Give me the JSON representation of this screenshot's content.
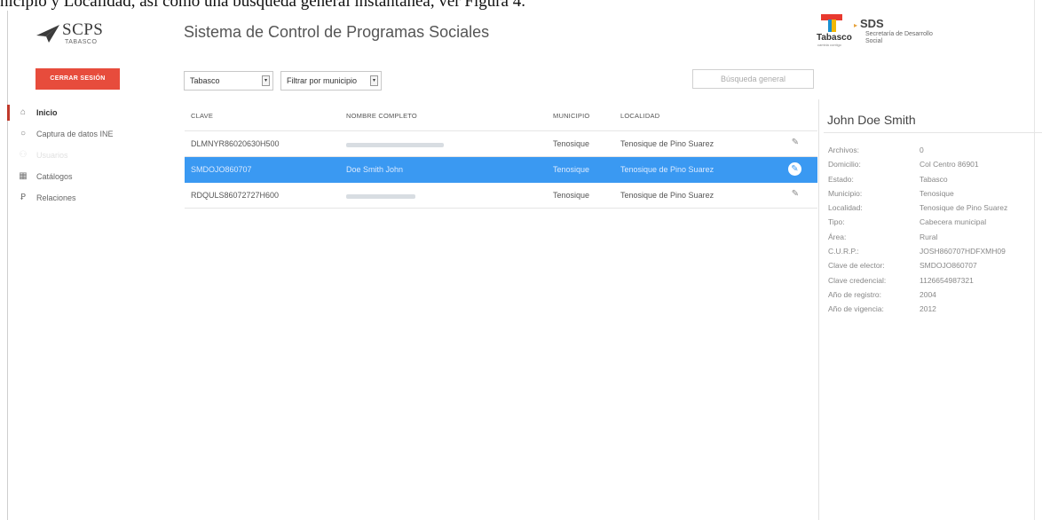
{
  "caption": "nicipio y Localidad, así como una búsqueda general instantánea, ver Figura 4.",
  "header": {
    "logo_title": "SCPS",
    "logo_subtitle": "TABASCO",
    "app_title": "Sistema de Control de Programas Sociales",
    "brand_state": "Tabasco",
    "brand_tagline": "cambia contigo",
    "brand_sds": "SDS",
    "brand_sds_sub": "Secretaría de Desarrollo Social",
    "logout_label": "CERRAR SESIÓN"
  },
  "filters": {
    "state_select": "Tabasco",
    "municipio_select": "Filtrar por municipio",
    "search_placeholder": "Búsqueda general"
  },
  "sidebar": {
    "items": [
      {
        "label": "Inicio",
        "icon": "home-icon",
        "state": "active"
      },
      {
        "label": "Captura de datos INE",
        "icon": "circle-icon",
        "state": "normal"
      },
      {
        "label": "Usuarios",
        "icon": "users-icon",
        "state": "disabled"
      },
      {
        "label": "Catálogos",
        "icon": "table-icon",
        "state": "normal"
      },
      {
        "label": "Relaciones",
        "icon": "relations-icon",
        "state": "normal"
      }
    ]
  },
  "table": {
    "columns": [
      "CLAVE",
      "NOMBRE COMPLETO",
      "MUNICIPIO",
      "LOCALIDAD"
    ],
    "rows": [
      {
        "clave": "DLMNYR86020630H500",
        "nombre": "",
        "municipio": "Tenosique",
        "localidad": "Tenosique de Pino Suarez",
        "selected": false
      },
      {
        "clave": "SMDOJO860707",
        "nombre": "Doe Smith John",
        "municipio": "Tenosique",
        "localidad": "Tenosique de Pino Suarez",
        "selected": true
      },
      {
        "clave": "RDQULS86072727H600",
        "nombre": "",
        "municipio": "Tenosique",
        "localidad": "Tenosique de Pino Suarez",
        "selected": false
      }
    ]
  },
  "detail": {
    "name": "John Doe Smith",
    "fields": [
      {
        "label": "Archivos:",
        "value": "0"
      },
      {
        "label": "Domicilio:",
        "value": "Col Centro 86901"
      },
      {
        "label": "Estado:",
        "value": "Tabasco"
      },
      {
        "label": "Municipio:",
        "value": "Tenosique"
      },
      {
        "label": "Localidad:",
        "value": "Tenosique de Pino Suarez"
      },
      {
        "label": "Tipo:",
        "value": "Cabecera municipal"
      },
      {
        "label": "Área:",
        "value": "Rural"
      },
      {
        "label": "C.U.R.P.:",
        "value": "JOSH860707HDFXMH09"
      },
      {
        "label": "Clave de elector:",
        "value": "SMDOJO860707"
      },
      {
        "label": "Clave credencial:",
        "value": "1126654987321"
      },
      {
        "label": "Año de registro:",
        "value": "2004"
      },
      {
        "label": "Año de vigencia:",
        "value": "2012"
      }
    ]
  },
  "colors": {
    "accent": "#3a99f2",
    "logout": "#e74c3c",
    "active_marker": "#c0392b"
  }
}
